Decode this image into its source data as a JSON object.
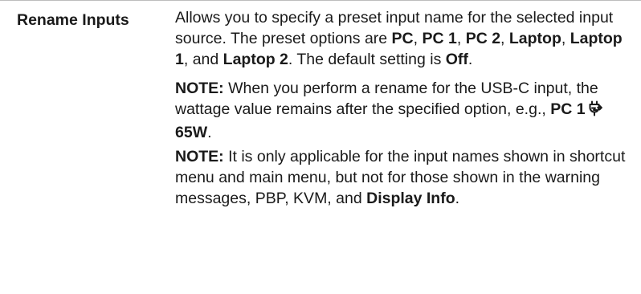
{
  "entry": {
    "term": "Rename Inputs",
    "description": {
      "intro_1": "Allows you to specify a preset input name for the selected input source. The preset options are ",
      "opt_pc": "PC",
      "sep_1": ", ",
      "opt_pc1": "PC 1",
      "sep_2": ", ",
      "opt_pc2": "PC 2",
      "sep_3": ", ",
      "opt_laptop": "Laptop",
      "sep_4": ", ",
      "opt_laptop1": "Laptop 1",
      "sep_5": ", and ",
      "opt_laptop2": "Laptop 2",
      "intro_2": ". The default setting is ",
      "default_value": "Off",
      "intro_end": "."
    },
    "note_1": {
      "label": "NOTE:",
      "text": " When you perform a rename for the USB-C input, the wattage value remains after the specified option, e.g., ",
      "example_name": "PC 1",
      "example_icon": "power-plug-icon",
      "example_watt": "65W",
      "end": "."
    },
    "note_2": {
      "label": "NOTE:",
      "text": " It is only applicable for the input names shown in shortcut menu and main menu, but not for those shown in the warning messages, PBP, KVM, and ",
      "emphasis": "Display Info",
      "end": "."
    }
  }
}
